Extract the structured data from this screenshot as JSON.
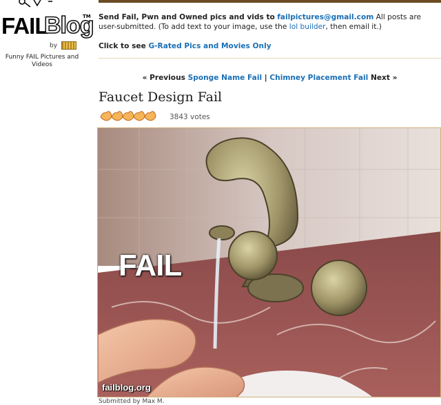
{
  "brand": {
    "logo_word_fail": "FAIL",
    "logo_word_blog": "Blog",
    "logo_tm": "TM",
    "by_label": "by",
    "tagline": "Funny FAIL Pictures and Videos"
  },
  "header": {
    "submit_lead": "Send Fail, Pwn and Owned pics and vids to",
    "submit_email": "failpictures@gmail.com",
    "submit_tail_1": "All posts are user-submitted. (To add text to your image, use the",
    "lol_builder_link": "lol builder",
    "submit_tail_2": ", then email it.)",
    "rated_lead": "Click to see",
    "rated_link": "G-Rated Pics and Movies Only"
  },
  "post_nav": {
    "prev_label": "« Previous",
    "prev_link": "Sponge Name Fail",
    "separator": "|",
    "next_link": "Chimney Placement Fail",
    "next_label": "Next »"
  },
  "post": {
    "title": "Faucet Design Fail",
    "rating_icon": "hand-rating-icon",
    "votes": "3843 votes",
    "image_caption": "FAIL",
    "watermark": "failblog.org",
    "submitted_by": "Submitted by Max M."
  },
  "colors": {
    "link": "#1a6fb5",
    "header_rule": "#6b4b21",
    "photo_border": "#cfb07a"
  }
}
